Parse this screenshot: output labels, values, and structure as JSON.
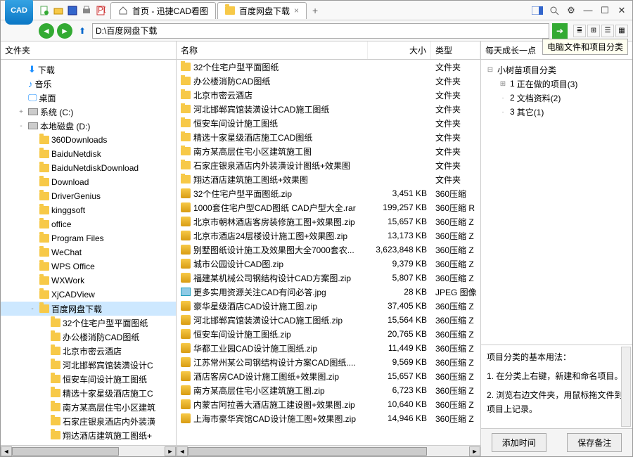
{
  "app_icon_text": "CAD",
  "titlebar_icons": [
    "new",
    "open",
    "save",
    "print",
    "pdf"
  ],
  "tabs": [
    {
      "label": "首页 - 迅捷CAD看图",
      "icon": "home"
    },
    {
      "label": "百度网盘下载",
      "icon": "folder",
      "closable": true
    }
  ],
  "hint_tooltip": "电脑文件和项目分类",
  "address_path": "D:\\百度网盘下载",
  "panel_left_title": "文件夹",
  "panel_mid_cols": {
    "name": "名称",
    "size": "大小",
    "type": "类型"
  },
  "panel_right_title": "每天成长一点",
  "tree_left": [
    {
      "depth": 1,
      "icon": "download",
      "label": "下载"
    },
    {
      "depth": 1,
      "icon": "music",
      "label": "音乐"
    },
    {
      "depth": 1,
      "icon": "desktop",
      "label": "桌面"
    },
    {
      "depth": 1,
      "icon": "disk",
      "label": "系统 (C:)",
      "expander": "+"
    },
    {
      "depth": 1,
      "icon": "disk",
      "label": "本地磁盘 (D:)",
      "expander": "-"
    },
    {
      "depth": 2,
      "icon": "folder",
      "label": "360Downloads"
    },
    {
      "depth": 2,
      "icon": "folder",
      "label": "BaiduNetdisk"
    },
    {
      "depth": 2,
      "icon": "folder",
      "label": "BaiduNetdiskDownload"
    },
    {
      "depth": 2,
      "icon": "folder",
      "label": "Download"
    },
    {
      "depth": 2,
      "icon": "folder",
      "label": "DriverGenius"
    },
    {
      "depth": 2,
      "icon": "folder",
      "label": "kinggsoft"
    },
    {
      "depth": 2,
      "icon": "folder",
      "label": "office"
    },
    {
      "depth": 2,
      "icon": "folder",
      "label": "Program Files"
    },
    {
      "depth": 2,
      "icon": "folder",
      "label": "WeChat"
    },
    {
      "depth": 2,
      "icon": "folder",
      "label": "WPS Office"
    },
    {
      "depth": 2,
      "icon": "folder",
      "label": "WXWork"
    },
    {
      "depth": 2,
      "icon": "folder",
      "label": "XjCADView"
    },
    {
      "depth": 2,
      "icon": "folder",
      "label": "百度网盘下载",
      "selected": true,
      "expander": "-"
    },
    {
      "depth": 3,
      "icon": "folder",
      "label": "32个住宅户型平面图纸"
    },
    {
      "depth": 3,
      "icon": "folder",
      "label": "办公楼消防CAD图纸"
    },
    {
      "depth": 3,
      "icon": "folder",
      "label": "北京市密云酒店"
    },
    {
      "depth": 3,
      "icon": "folder",
      "label": "河北邯郸宾馆装潢设计C"
    },
    {
      "depth": 3,
      "icon": "folder",
      "label": "恒安车间设计施工图纸"
    },
    {
      "depth": 3,
      "icon": "folder",
      "label": "精选十家星级酒店施工C"
    },
    {
      "depth": 3,
      "icon": "folder",
      "label": "南方某高层住宅小区建筑"
    },
    {
      "depth": 3,
      "icon": "folder",
      "label": "石家庄银泉酒店内外装潢"
    },
    {
      "depth": 3,
      "icon": "folder",
      "label": "翔达酒店建筑施工图纸+"
    }
  ],
  "files": [
    {
      "icon": "folder",
      "name": "32个住宅户型平面图纸",
      "size": "",
      "type": "文件夹"
    },
    {
      "icon": "folder",
      "name": "办公楼消防CAD图纸",
      "size": "",
      "type": "文件夹"
    },
    {
      "icon": "folder",
      "name": "北京市密云酒店",
      "size": "",
      "type": "文件夹"
    },
    {
      "icon": "folder",
      "name": "河北邯郸宾馆装潢设计CAD施工图纸",
      "size": "",
      "type": "文件夹"
    },
    {
      "icon": "folder",
      "name": "恒安车间设计施工图纸",
      "size": "",
      "type": "文件夹"
    },
    {
      "icon": "folder",
      "name": "精选十家星级酒店施工CAD图纸",
      "size": "",
      "type": "文件夹"
    },
    {
      "icon": "folder",
      "name": "南方某高层住宅小区建筑施工图",
      "size": "",
      "type": "文件夹"
    },
    {
      "icon": "folder",
      "name": "石家庄银泉酒店内外装潢设计图纸+效果图",
      "size": "",
      "type": "文件夹"
    },
    {
      "icon": "folder",
      "name": "翔达酒店建筑施工图纸+效果图",
      "size": "",
      "type": "文件夹"
    },
    {
      "icon": "zip",
      "name": "32个住宅户型平面图纸.zip",
      "size": "3,451 KB",
      "type": "360压缩"
    },
    {
      "icon": "zip",
      "name": "1000套住宅户型CAD图纸 CAD户型大全.rar",
      "size": "199,257 KB",
      "type": "360压缩 R"
    },
    {
      "icon": "zip",
      "name": "北京市朝林酒店客房装修施工图+效果图.zip",
      "size": "15,657 KB",
      "type": "360压缩 Z"
    },
    {
      "icon": "zip",
      "name": "北京市酒店24层楼设计施工图+效果图.zip",
      "size": "13,173 KB",
      "type": "360压缩 Z"
    },
    {
      "icon": "zip",
      "name": "别墅图纸设计施工及效果图大全7000套农...",
      "size": "3,623,848 KB",
      "type": "360压缩 Z"
    },
    {
      "icon": "zip",
      "name": "城市公园设计CAD图.zip",
      "size": "9,379 KB",
      "type": "360压缩 Z"
    },
    {
      "icon": "zip",
      "name": "福建某机械公司钢结构设计CAD方案图.zip",
      "size": "5,807 KB",
      "type": "360压缩 Z"
    },
    {
      "icon": "img",
      "name": "更多实用资源关注CAD有问必答.jpg",
      "size": "28 KB",
      "type": "JPEG 图像"
    },
    {
      "icon": "zip",
      "name": "豪华星级酒店CAD设计施工图.zip",
      "size": "37,405 KB",
      "type": "360压缩 Z"
    },
    {
      "icon": "zip",
      "name": "河北邯郸宾馆装潢设计CAD施工图纸.zip",
      "size": "15,564 KB",
      "type": "360压缩 Z"
    },
    {
      "icon": "zip",
      "name": "恒安车间设计施工图纸.zip",
      "size": "20,765 KB",
      "type": "360压缩 Z"
    },
    {
      "icon": "zip",
      "name": "华都工业园CAD设计施工图纸.zip",
      "size": "11,449 KB",
      "type": "360压缩 Z"
    },
    {
      "icon": "zip",
      "name": "江苏常州某公司钢结构设计方案CAD图纸....",
      "size": "9,569 KB",
      "type": "360压缩 Z"
    },
    {
      "icon": "zip",
      "name": "酒店客房CAD设计施工图纸+效果图.zip",
      "size": "15,657 KB",
      "type": "360压缩 Z"
    },
    {
      "icon": "zip",
      "name": "南方某高层住宅小区建筑施工图.zip",
      "size": "6,723 KB",
      "type": "360压缩 Z"
    },
    {
      "icon": "zip",
      "name": "内蒙古阿拉善大酒店施工建设图+效果图.zip",
      "size": "10,640 KB",
      "type": "360压缩 Z"
    },
    {
      "icon": "zip",
      "name": "上海市豪华宾馆CAD设计施工图+效果图.zip",
      "size": "14,946 KB",
      "type": "360压缩 Z"
    }
  ],
  "right_tree": {
    "root": {
      "expander": "⊟",
      "label": "小树苗项目分类"
    },
    "items": [
      {
        "expander": "⊞",
        "bullet": "1",
        "label": "正在做的项目(3)"
      },
      {
        "expander": "",
        "bullet": "2",
        "label": "文档资料(2)"
      },
      {
        "expander": "",
        "bullet": "3",
        "label": "其它(1)"
      }
    ]
  },
  "right_help": {
    "title": "项目分类的基本用法：",
    "p1": "1. 在分类上右键，新建和命名项目。",
    "p2": "2. 浏览右边文件夹，用鼠标拖文件到项目上记录。"
  },
  "right_buttons": {
    "add": "添加时间",
    "save": "保存备注"
  }
}
